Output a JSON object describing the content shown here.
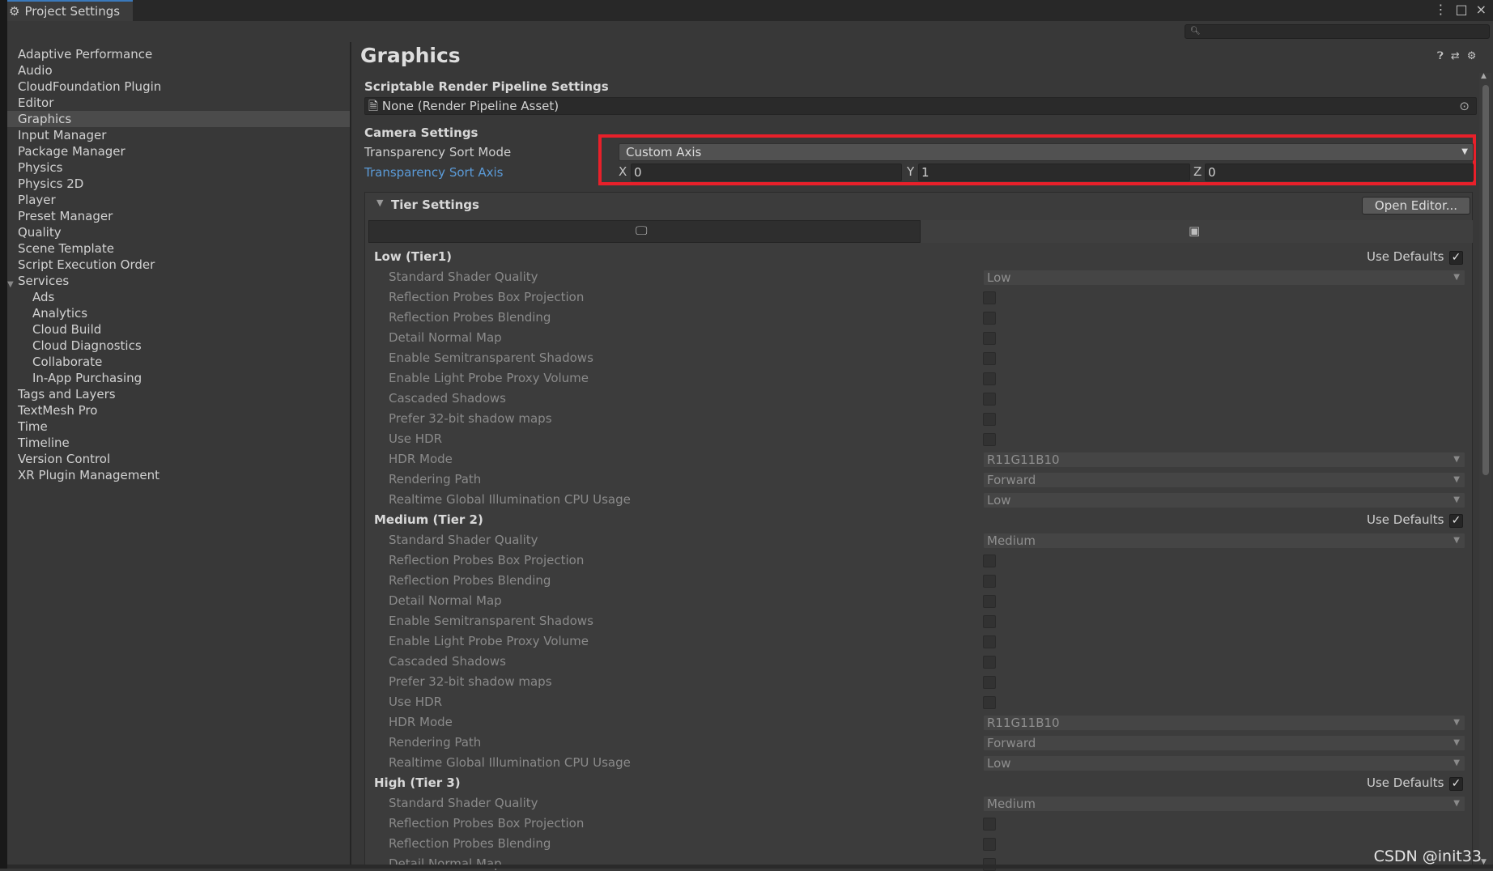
{
  "window": {
    "tab_title": "Project Settings",
    "search_placeholder": "",
    "controls": [
      "⋮",
      "□",
      "×"
    ]
  },
  "sidebar": {
    "items": [
      {
        "label": "Adaptive Performance"
      },
      {
        "label": "Audio"
      },
      {
        "label": "CloudFoundation Plugin"
      },
      {
        "label": "Editor"
      },
      {
        "label": "Graphics",
        "selected": true
      },
      {
        "label": "Input Manager"
      },
      {
        "label": "Package Manager"
      },
      {
        "label": "Physics"
      },
      {
        "label": "Physics 2D"
      },
      {
        "label": "Player"
      },
      {
        "label": "Preset Manager"
      },
      {
        "label": "Quality"
      },
      {
        "label": "Scene Template"
      },
      {
        "label": "Script Execution Order"
      },
      {
        "label": "Services",
        "expanded": true
      },
      {
        "label": "Ads",
        "child": true
      },
      {
        "label": "Analytics",
        "child": true
      },
      {
        "label": "Cloud Build",
        "child": true
      },
      {
        "label": "Cloud Diagnostics",
        "child": true
      },
      {
        "label": "Collaborate",
        "child": true
      },
      {
        "label": "In-App Purchasing",
        "child": true
      },
      {
        "label": "Tags and Layers"
      },
      {
        "label": "TextMesh Pro"
      },
      {
        "label": "Time"
      },
      {
        "label": "Timeline"
      },
      {
        "label": "Version Control"
      },
      {
        "label": "XR Plugin Management"
      }
    ]
  },
  "main": {
    "title": "Graphics",
    "header_icons": [
      "help-icon",
      "preset-icon",
      "settings-icon"
    ],
    "srp": {
      "heading": "Scriptable Render Pipeline Settings",
      "value": "None (Render Pipeline Asset)"
    },
    "camera": {
      "heading": "Camera Settings",
      "sort_mode_label": "Transparency Sort Mode",
      "sort_mode_value": "Custom Axis",
      "sort_axis_label": "Transparency Sort Axis",
      "x_label": "X",
      "x_value": "0",
      "y_label": "Y",
      "y_value": "1",
      "z_label": "Z",
      "z_value": "0"
    },
    "tier": {
      "heading": "Tier Settings",
      "open_editor": "Open Editor...",
      "use_defaults": "Use Defaults",
      "tiers": [
        {
          "name": "Low (Tier1)",
          "rows": [
            {
              "label": "Standard Shader Quality",
              "type": "dropdown",
              "value": "Low"
            },
            {
              "label": "Reflection Probes Box Projection",
              "type": "checkbox"
            },
            {
              "label": "Reflection Probes Blending",
              "type": "checkbox"
            },
            {
              "label": "Detail Normal Map",
              "type": "checkbox"
            },
            {
              "label": "Enable Semitransparent Shadows",
              "type": "checkbox"
            },
            {
              "label": "Enable Light Probe Proxy Volume",
              "type": "checkbox"
            },
            {
              "label": "Cascaded Shadows",
              "type": "checkbox"
            },
            {
              "label": "Prefer 32-bit shadow maps",
              "type": "checkbox"
            },
            {
              "label": "Use HDR",
              "type": "checkbox"
            },
            {
              "label": "HDR Mode",
              "type": "dropdown",
              "value": "R11G11B10"
            },
            {
              "label": "Rendering Path",
              "type": "dropdown",
              "value": "Forward"
            },
            {
              "label": "Realtime Global Illumination CPU Usage",
              "type": "dropdown",
              "value": "Low"
            }
          ]
        },
        {
          "name": "Medium (Tier 2)",
          "rows": [
            {
              "label": "Standard Shader Quality",
              "type": "dropdown",
              "value": "Medium"
            },
            {
              "label": "Reflection Probes Box Projection",
              "type": "checkbox"
            },
            {
              "label": "Reflection Probes Blending",
              "type": "checkbox"
            },
            {
              "label": "Detail Normal Map",
              "type": "checkbox"
            },
            {
              "label": "Enable Semitransparent Shadows",
              "type": "checkbox"
            },
            {
              "label": "Enable Light Probe Proxy Volume",
              "type": "checkbox"
            },
            {
              "label": "Cascaded Shadows",
              "type": "checkbox"
            },
            {
              "label": "Prefer 32-bit shadow maps",
              "type": "checkbox"
            },
            {
              "label": "Use HDR",
              "type": "checkbox"
            },
            {
              "label": "HDR Mode",
              "type": "dropdown",
              "value": "R11G11B10"
            },
            {
              "label": "Rendering Path",
              "type": "dropdown",
              "value": "Forward"
            },
            {
              "label": "Realtime Global Illumination CPU Usage",
              "type": "dropdown",
              "value": "Low"
            }
          ]
        },
        {
          "name": "High (Tier 3)",
          "rows": [
            {
              "label": "Standard Shader Quality",
              "type": "dropdown",
              "value": "Medium"
            },
            {
              "label": "Reflection Probes Box Projection",
              "type": "checkbox"
            },
            {
              "label": "Reflection Probes Blending",
              "type": "checkbox"
            },
            {
              "label": "Detail Normal Map",
              "type": "checkbox"
            }
          ]
        }
      ]
    }
  },
  "watermark": "CSDN @init33",
  "colors": {
    "highlight": "#e8202a",
    "link": "#5b9bd8",
    "accent_tab": "#3a79bb"
  }
}
